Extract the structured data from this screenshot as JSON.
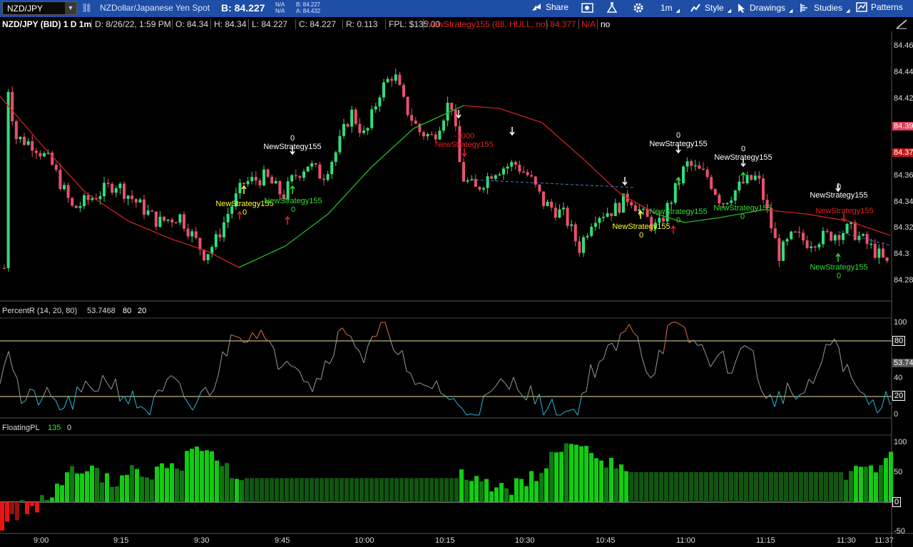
{
  "toolbar": {
    "symbol": "NZD/JPY",
    "description": "NZDollar/Japanese Yen Spot",
    "bid_display": "B: 84.227",
    "na_top": "N/A",
    "na_bottom": "N/A",
    "bid_small": "B: 84.227",
    "ask_small": "A: 84.432",
    "share": "Share",
    "timeframe": "1m",
    "style": "Style",
    "drawings": "Drawings",
    "studies": "Studies",
    "patterns": "Patterns"
  },
  "infobar": {
    "title": "NZD/JPY (BID) 1 D 1m",
    "date": "D: 8/26/22, 1:59 PM",
    "open": "O: 84.34",
    "high": "H: 84.34",
    "low": "L: 84.227",
    "close": "C: 84.227",
    "range": "R: 0.113",
    "fpl": "FPL: $135.00",
    "strategy": "NewStrategy155 (88, HULL, no)",
    "strategy_value": "84.377",
    "na": "N/A",
    "no": "no"
  },
  "price_axis": [
    "84.46",
    "84.44",
    "84.42",
    "84.36",
    "84.34",
    "84.32",
    "84.3",
    "84.28"
  ],
  "price_badges": [
    {
      "label": "84.39",
      "color": "#e0405a"
    },
    {
      "label": "84.37",
      "color": "#c01818"
    }
  ],
  "percentr": {
    "label": "PercentR (14, 20, 80)",
    "value": "53.7468",
    "high": "80",
    "low": "20",
    "axis": [
      "100",
      "40",
      "0"
    ],
    "badge_80": "80",
    "badge_value": "53.74",
    "badge_20": "20"
  },
  "floatingpl": {
    "label": "FloatingPL",
    "value": "135",
    "zero": "0",
    "axis": [
      "100",
      "50",
      "0",
      "-50"
    ]
  },
  "time_axis": [
    "9:00",
    "9:15",
    "9:30",
    "9:45",
    "10:00",
    "10:15",
    "10:30",
    "10:45",
    "11:00",
    "11:15",
    "11:30",
    "11:37"
  ],
  "signals": [
    {
      "name": "NewStrategy155",
      "qty": "0",
      "color": "#ffffff"
    },
    {
      "name": "NewStrategy155",
      "qty": "0",
      "color": "#ffff33"
    },
    {
      "name": "NewStrategy155",
      "qty": "0",
      "color": "#33dd33"
    },
    {
      "name": "NewStrategy155",
      "qty": "-1000",
      "color": "#e02020"
    },
    {
      "name": "NewStrategy155",
      "qty": "0",
      "color": "#ffffff"
    },
    {
      "name": "NewStrategy155",
      "qty": "0",
      "color": "#ffff33"
    },
    {
      "name": "NewStrategy155",
      "qty": "0",
      "color": "#33dd33"
    },
    {
      "name": "NewStrategy155",
      "qty": "0",
      "color": "#ffffff"
    },
    {
      "name": "NewStrategy155",
      "qty": "0",
      "color": "#33dd33"
    },
    {
      "name": "NewStrategy155",
      "qty": "0",
      "color": "#ffffff"
    },
    {
      "name": "NewStrategy155",
      "qty": "",
      "color": "#e02020"
    },
    {
      "name": "NewStrategy155",
      "qty": "0",
      "color": "#33dd33"
    }
  ],
  "colors": {
    "toolbar": "#1f4ea6",
    "bull": "#33dd77",
    "bear": "#e8506e",
    "hull_up": "#22bb22",
    "hull_down": "#cc2222"
  }
}
